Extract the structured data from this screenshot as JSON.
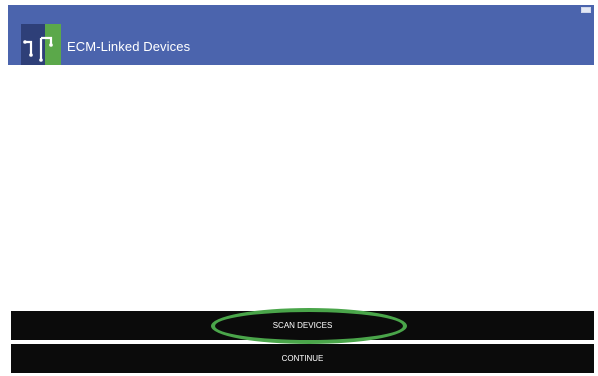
{
  "app_bar": {
    "title": "ECM-Linked Devices",
    "logo_icon": "ecm-circuit-logo-icon"
  },
  "buttons": {
    "scan_label": "SCAN DEVICES",
    "continue_label": "CONTINUE"
  },
  "colors": {
    "app_bar": "#4b64ad",
    "button_background": "#0b0b0b",
    "highlight_ring": "#4aa54a"
  }
}
